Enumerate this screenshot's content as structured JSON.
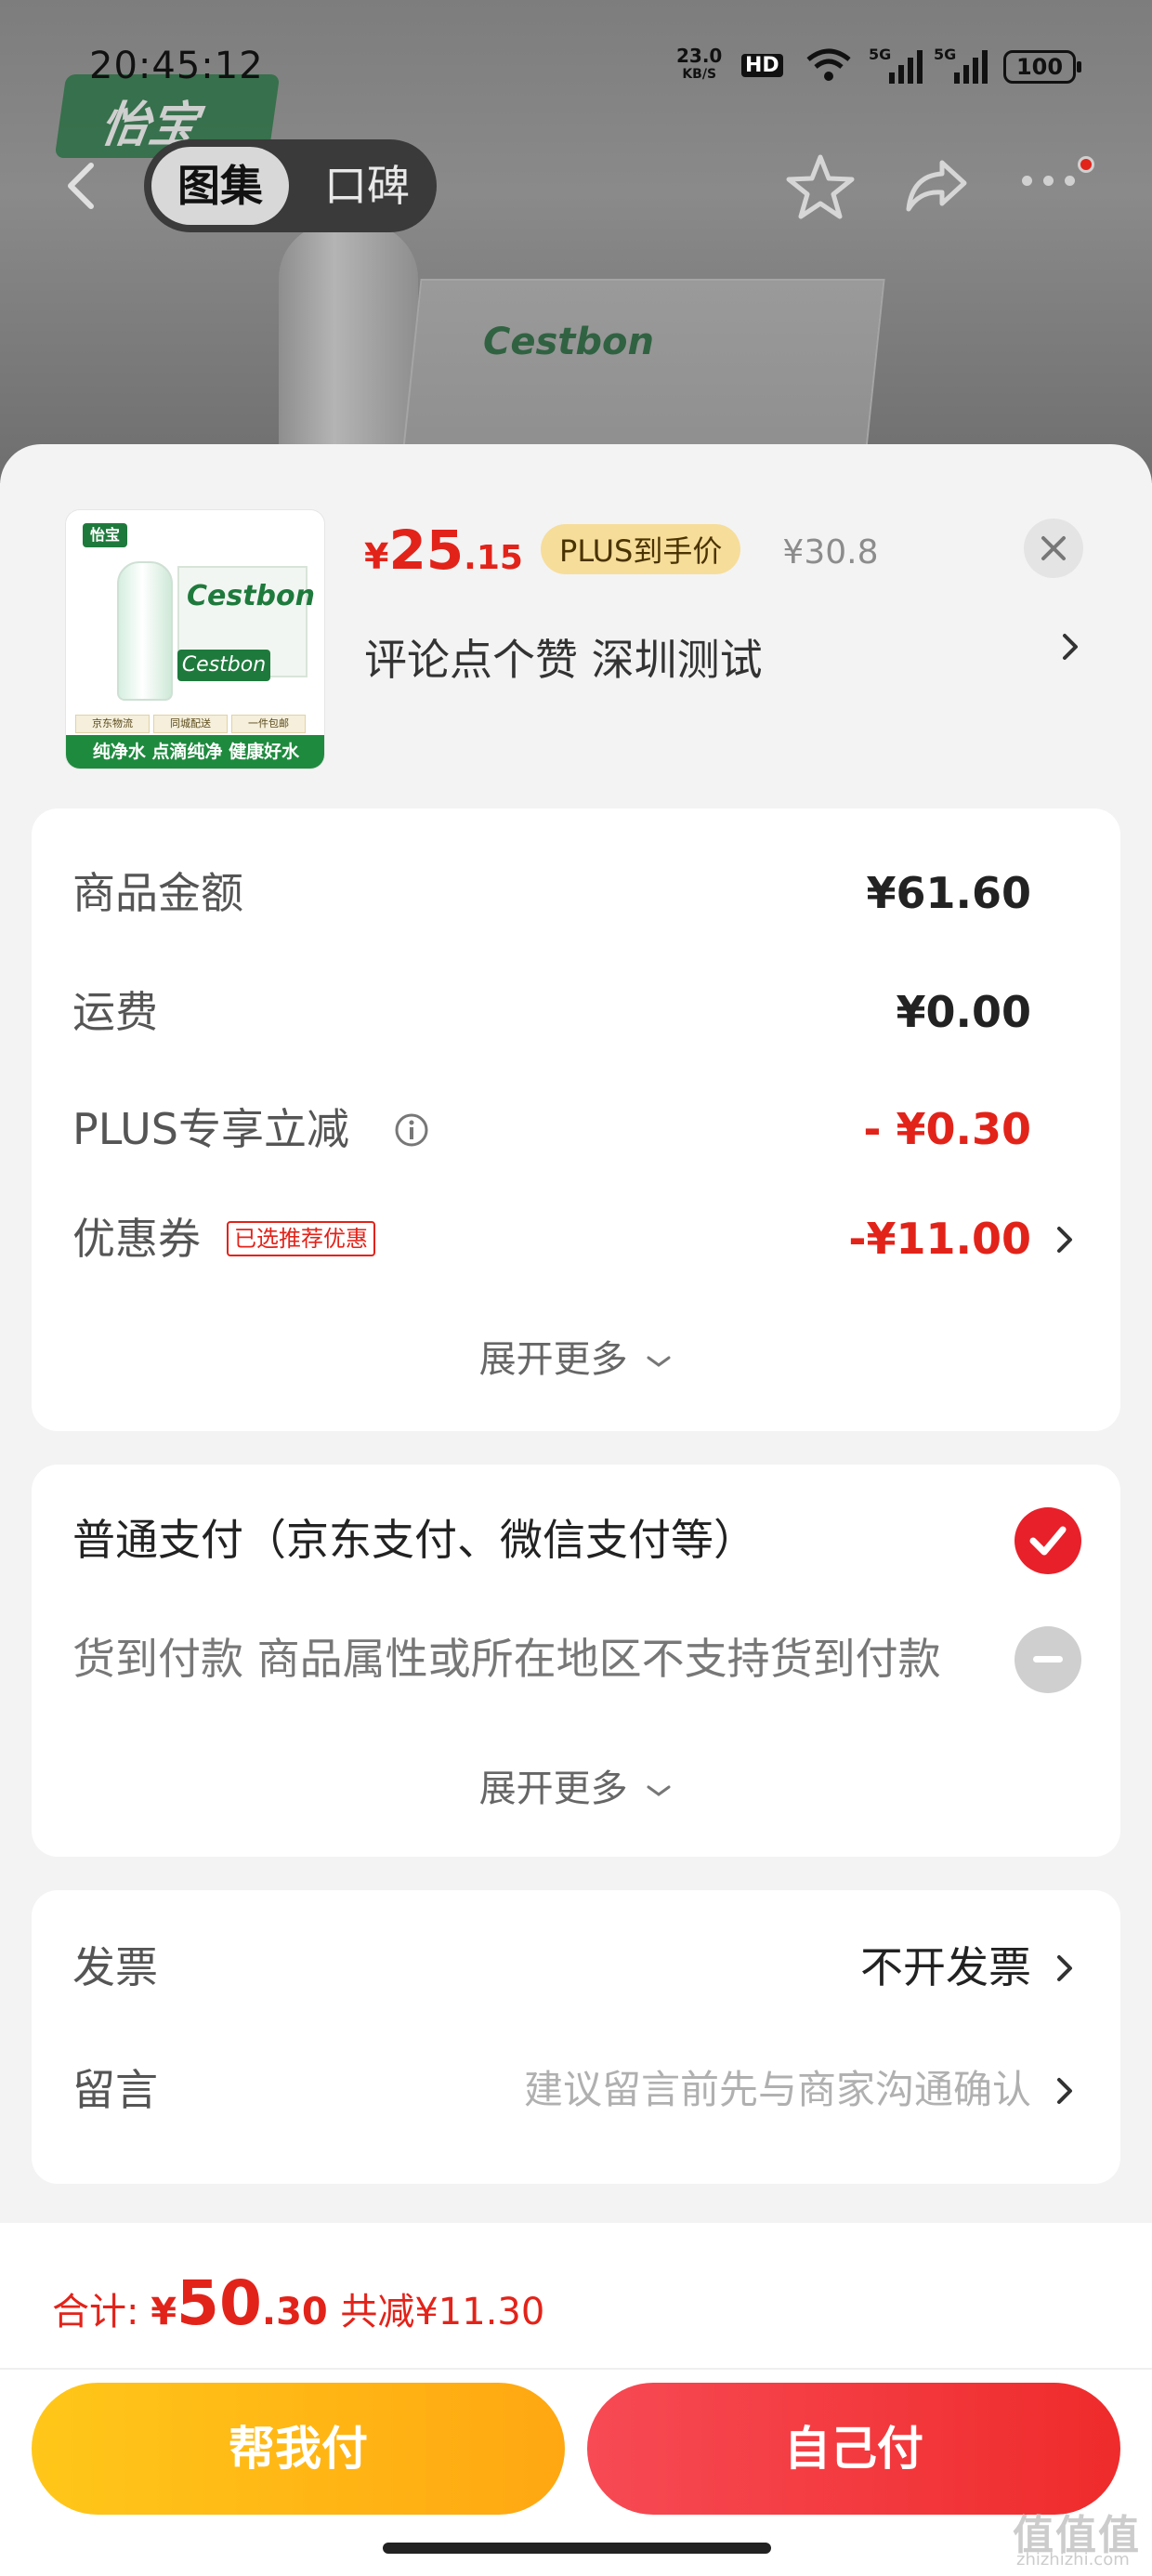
{
  "status_bar": {
    "time": "20:45:12",
    "net_speed": "23.0",
    "net_unit": "KB/S",
    "hd_label": "HD",
    "signal1": "5G",
    "signal2": "5G",
    "battery": "100"
  },
  "nav": {
    "tab_active": "图集",
    "tab_other": "口碑"
  },
  "product": {
    "price_yen": "¥",
    "price_int": "25",
    "price_dec": ".15",
    "plus_tag": "PLUS到手价",
    "original_price": "¥30.8",
    "subtitle": "评论点个赞  深圳测试",
    "thumb_brand": "Cestbon",
    "thumb_logo": "怡宝",
    "thumb_tags": [
      "京东物流",
      "同城配送",
      "一件包邮"
    ],
    "thumb_footer": "纯净水 点滴纯净 健康好水"
  },
  "summary": {
    "rows": [
      {
        "label": "商品金额",
        "value": "¥61.60"
      },
      {
        "label": "运费",
        "value": "¥0.00"
      },
      {
        "label": "PLUS专享立减",
        "value": "- ¥0.30"
      },
      {
        "label": "优惠券",
        "tag": "已选推荐优惠",
        "value": "-¥11.00"
      }
    ],
    "expand": "展开更多"
  },
  "payment": {
    "option1": "普通支付（京东支付、微信支付等）",
    "option2": "货到付款 商品属性或所在地区不支持货到付款",
    "expand": "展开更多"
  },
  "extra": {
    "invoice_label": "发票",
    "invoice_value": "不开发票",
    "message_label": "留言",
    "message_placeholder": "建议留言前先与商家沟通确认"
  },
  "footer": {
    "total_label": "合计: ",
    "total_yen": "¥",
    "total_int": "50",
    "total_dec": ".30",
    "total_save": "共减¥11.30",
    "btn_help": "帮我付",
    "btn_self": "自己付",
    "watermark": "值值值",
    "watermark_sub": "zhizhizhi.com"
  },
  "colors": {
    "accent_red": "#e2231a",
    "plus_gold": "#f6dd9a",
    "btn_yellow": "#ffb716"
  }
}
